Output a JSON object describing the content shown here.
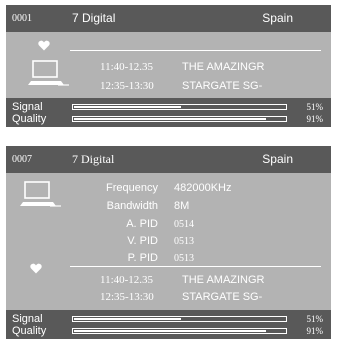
{
  "panel1": {
    "channel_number": "0001",
    "channel_name": "7 Digital",
    "country": "Spain",
    "program_now": {
      "time": "11:40-12.35",
      "title": "THE AMAZINGR"
    },
    "program_next": {
      "time": "12:35-13:30",
      "title": "STARGATE SG-"
    },
    "signal_label": "Signal",
    "quality_label": "Quality",
    "signal_percent": "51%",
    "quality_percent": "91%",
    "signal_level": 0.51,
    "quality_level": 0.91
  },
  "panel2": {
    "channel_number": "0007",
    "channel_name": "7 Digital",
    "country": "Spain",
    "info": [
      {
        "label": "Frequency",
        "value": "482000KHz"
      },
      {
        "label": "Bandwidth",
        "value": "8M"
      },
      {
        "label": "A. PID",
        "value": "0514"
      },
      {
        "label": "V. PID",
        "value": "0513"
      },
      {
        "label": "P. PID",
        "value": "0513"
      }
    ],
    "program_now": {
      "time": "11:40-12.35",
      "title": "THE AMAZINGR"
    },
    "program_next": {
      "time": "12:35-13:30",
      "title": "STARGATE SG-"
    },
    "signal_label": "Signal",
    "quality_label": "Quality",
    "signal_percent": "51%",
    "quality_percent": "91%",
    "signal_level": 0.51,
    "quality_level": 0.91
  },
  "colors": {
    "panel_bg": "#b3b3b3",
    "header_bg": "#595959",
    "text": "#ffffff"
  },
  "icons": {
    "favorite": "heart-icon",
    "device": "laptop-icon"
  }
}
